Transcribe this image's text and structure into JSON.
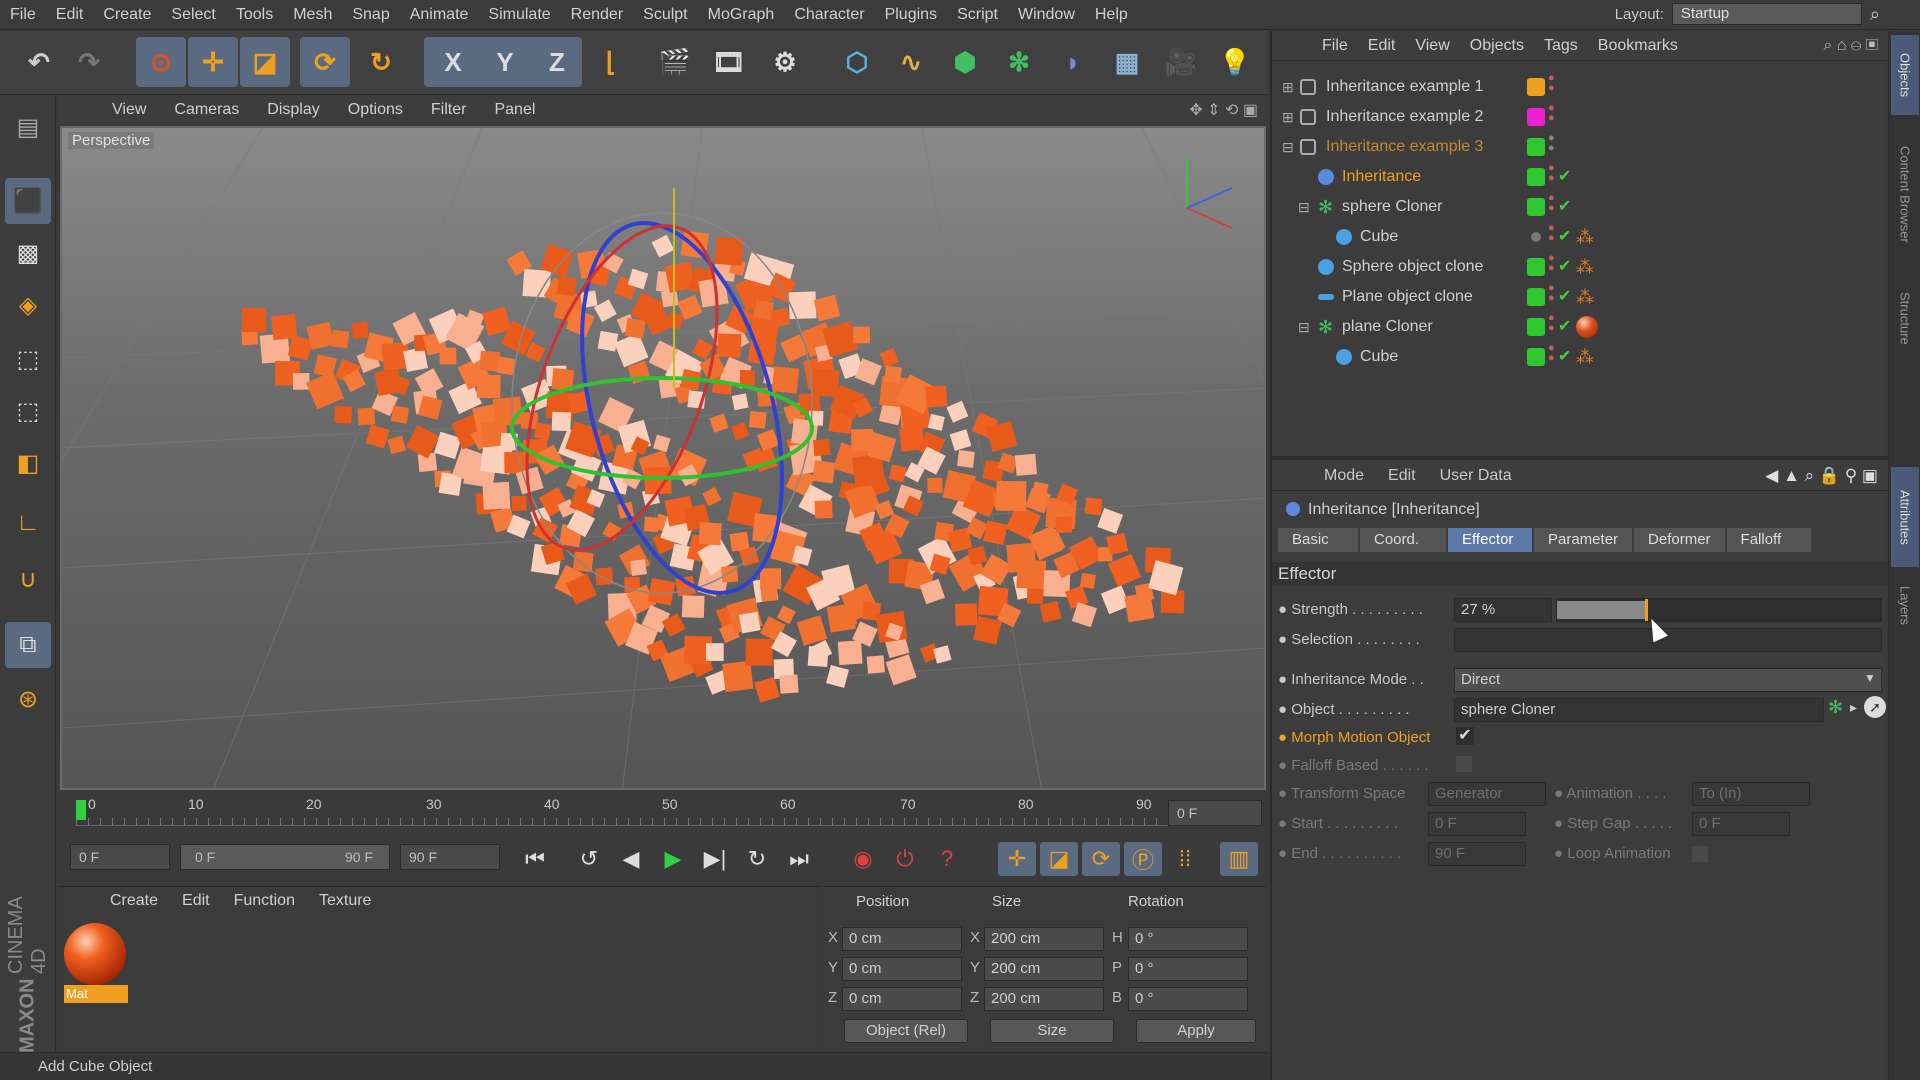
{
  "menubar": {
    "items": [
      "File",
      "Edit",
      "Create",
      "Select",
      "Tools",
      "Mesh",
      "Snap",
      "Animate",
      "Simulate",
      "Render",
      "Sculpt",
      "MoGraph",
      "Character",
      "Plugins",
      "Script",
      "Window",
      "Help"
    ],
    "layout_label": "Layout:",
    "layout_value": "Startup"
  },
  "toolbar": {
    "icons": [
      "undo-icon",
      "redo-icon",
      "live-select-icon",
      "move-icon",
      "scale-icon",
      "rotate-icon",
      "recent-tool-icon",
      "x-axis-icon",
      "y-axis-icon",
      "z-axis-icon",
      "coordinate-system-icon",
      "render-view-icon",
      "render-picture-viewer-icon",
      "edit-render-settings-icon",
      "cube-icon",
      "spline-pen-icon",
      "subdivision-surface-icon",
      "cloner-icon",
      "deformer-icon",
      "floor-icon",
      "camera-icon",
      "light-icon"
    ],
    "x_label": "X",
    "y_label": "Y",
    "z_label": "Z"
  },
  "viewport": {
    "menu": [
      "View",
      "Cameras",
      "Display",
      "Options",
      "Filter",
      "Panel"
    ],
    "label": "Perspective"
  },
  "timeline": {
    "ticks": [
      "0",
      "10",
      "20",
      "30",
      "40",
      "50",
      "60",
      "70",
      "80",
      "90"
    ],
    "current_frame": "0 F"
  },
  "playbar": {
    "start": "0 F",
    "range_start": "0 F",
    "range_end": "90 F",
    "end": "90 F"
  },
  "material": {
    "menu": [
      "Create",
      "Edit",
      "Function",
      "Texture"
    ],
    "mat_name": "Mat"
  },
  "coords": {
    "headers": [
      "Position",
      "Size",
      "Rotation"
    ],
    "pos": {
      "x": "0 cm",
      "y": "0 cm",
      "z": "0 cm"
    },
    "size": {
      "x": "200 cm",
      "y": "200 cm",
      "z": "200 cm"
    },
    "rot": {
      "h": "0 °",
      "p": "0 °",
      "b": "0 °"
    },
    "axis_labels": {
      "x": "X",
      "y": "Y",
      "z": "Z",
      "h": "H",
      "p": "P",
      "b": "B"
    },
    "mode": "Object (Rel)",
    "size_mode": "Size",
    "apply": "Apply"
  },
  "status": "Add Cube Object",
  "brand": {
    "maxon": "MAXON",
    "c4d": "CINEMA 4D"
  },
  "objects": {
    "menu": [
      "File",
      "Edit",
      "View",
      "Objects",
      "Tags",
      "Bookmarks"
    ],
    "rows": [
      {
        "name": "Inheritance example 1",
        "color": "#f0a020"
      },
      {
        "name": "Inheritance example 2",
        "color": "#f020d0"
      },
      {
        "name": "Inheritance example 3",
        "color": "#30c830"
      },
      {
        "name": "Inheritance",
        "color": "#30c830"
      },
      {
        "name": "sphere Cloner",
        "color": "#30c830"
      },
      {
        "name": "Cube",
        "color": "#777777"
      },
      {
        "name": "Sphere object clone",
        "color": "#30c830"
      },
      {
        "name": "Plane object clone",
        "color": "#30c830"
      },
      {
        "name": "plane Cloner",
        "color": "#30c830"
      },
      {
        "name": "Cube",
        "color": "#30c830"
      }
    ]
  },
  "attributes": {
    "menu": [
      "Mode",
      "Edit",
      "User Data"
    ],
    "title": "Inheritance [Inheritance]",
    "tabs": [
      "Basic",
      "Coord.",
      "Effector",
      "Parameter",
      "Deformer",
      "Falloff"
    ],
    "section": "Effector",
    "strength_label": "Strength . . . . . . . . .",
    "strength_value": "27 %",
    "strength_fraction": 0.27,
    "selection_label": "Selection . . . . . . . .",
    "mode_label": "Inheritance Mode . .",
    "mode_value": "Direct",
    "object_label": "Object . . . . . . . . .",
    "object_value": "sphere Cloner",
    "morph_label": "Morph Motion Object",
    "falloff_label": "Falloff Based . . . . . .",
    "transform_label": "Transform Space",
    "transform_value": "Generator",
    "animation_label": "Animation . . . .",
    "animation_value": "To (In)",
    "start_label": "Start . . . . . . . . .",
    "start_value": "0 F",
    "stepgap_label": "Step Gap . . . . .",
    "stepgap_value": "0 F",
    "end_label": "End . . . . . . . . . .",
    "end_value": "90 F",
    "loop_label": "Loop Animation"
  },
  "sidetabs": [
    "Objects",
    "Content Browser",
    "Structure",
    "Attributes",
    "Layers"
  ]
}
